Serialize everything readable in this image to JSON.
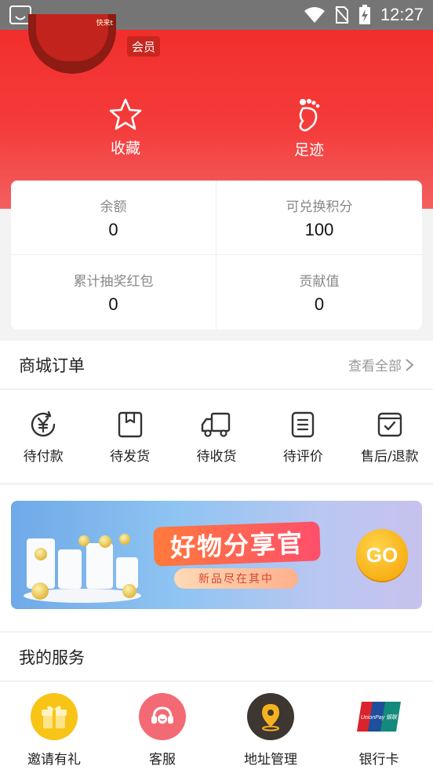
{
  "status_bar": {
    "time": "12:27"
  },
  "header": {
    "avatar_text": "快来t",
    "member_badge": "会员",
    "favorites_label": "收藏",
    "footprints_label": "足迹"
  },
  "stats": [
    {
      "label": "余额",
      "value": "0"
    },
    {
      "label": "可兑换积分",
      "value": "100"
    },
    {
      "label": "累计抽奖红包",
      "value": "0"
    },
    {
      "label": "贡献值",
      "value": "0"
    }
  ],
  "orders": {
    "title": "商城订单",
    "view_all": "查看全部",
    "items": [
      {
        "label": "待付款",
        "icon": "yen-clock-icon"
      },
      {
        "label": "待发货",
        "icon": "package-icon"
      },
      {
        "label": "待收货",
        "icon": "truck-icon"
      },
      {
        "label": "待评价",
        "icon": "review-icon"
      },
      {
        "label": "售后/退款",
        "icon": "after-sale-icon"
      }
    ]
  },
  "banner": {
    "title": "好物分享官",
    "subtitle": "新品尽在其中",
    "go_label": "GO"
  },
  "services": {
    "title": "我的服务",
    "items": [
      {
        "label": "邀请有礼",
        "icon": "gift-icon",
        "color": "#f7c31a"
      },
      {
        "label": "客服",
        "icon": "customer-service-icon",
        "color": "#f2606a"
      },
      {
        "label": "地址管理",
        "icon": "location-icon",
        "color": "#3b3530"
      },
      {
        "label": "银行卡",
        "icon": "unionpay-icon",
        "color": "#d9242b",
        "logo_text": "UnionPay 银联"
      }
    ]
  }
}
